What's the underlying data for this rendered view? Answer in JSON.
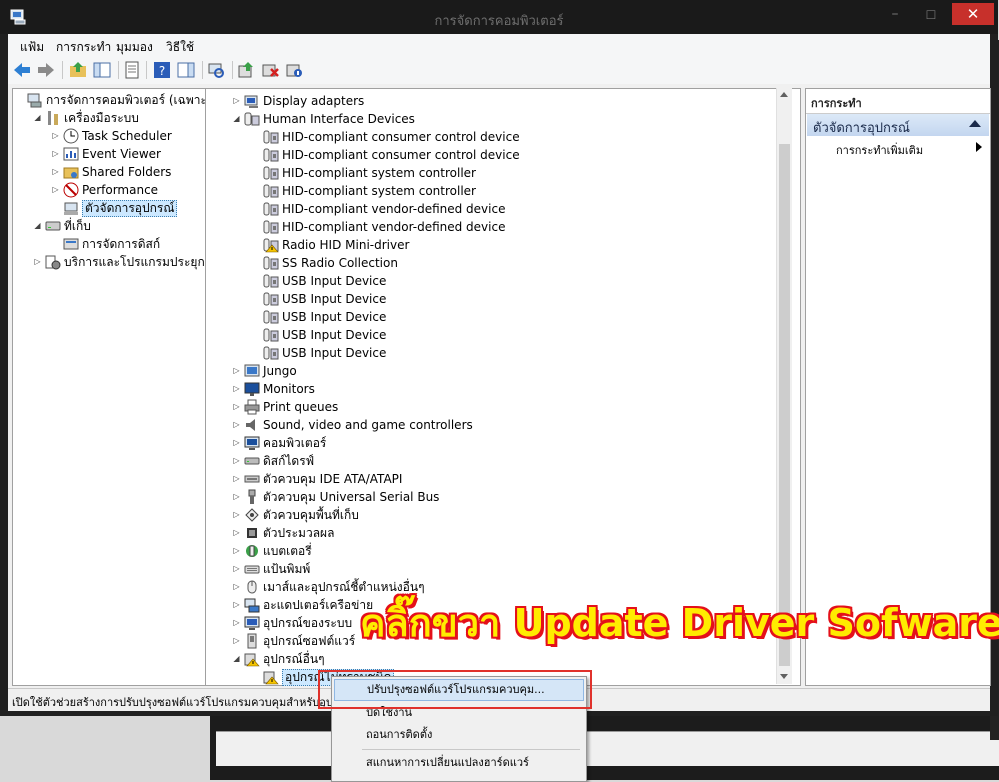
{
  "window": {
    "title": "การจัดการคอมพิวเตอร์",
    "minimize_glyph": "–",
    "maximize_glyph": "☐",
    "close_glyph": "✕"
  },
  "menu": [
    "แฟ้ม",
    "การกระทำ",
    "มุมมอง",
    "วิธีใช้"
  ],
  "left_tree": [
    {
      "label": "การจัดการคอมพิวเตอร์ (เฉพาะที่)",
      "icon": "computer-management-icon",
      "level": 0,
      "arrow": ""
    },
    {
      "label": "เครื่องมือระบบ",
      "icon": "tools-icon",
      "level": 1,
      "arrow": "expanded"
    },
    {
      "label": "Task Scheduler",
      "icon": "clock-icon",
      "level": 2,
      "arrow": "collapsed"
    },
    {
      "label": "Event Viewer",
      "icon": "event-viewer-icon",
      "level": 2,
      "arrow": "collapsed"
    },
    {
      "label": "Shared Folders",
      "icon": "shared-folder-icon",
      "level": 2,
      "arrow": "collapsed"
    },
    {
      "label": "Performance",
      "icon": "performance-icon",
      "level": 2,
      "arrow": "collapsed"
    },
    {
      "label": "ตัวจัดการอุปกรณ์",
      "icon": "device-manager-icon",
      "level": 2,
      "arrow": "",
      "selected": true
    },
    {
      "label": "ที่เก็บ",
      "icon": "storage-icon",
      "level": 1,
      "arrow": "expanded"
    },
    {
      "label": "การจัดการดิสก์",
      "icon": "disk-icon",
      "level": 2,
      "arrow": ""
    },
    {
      "label": "บริการและโปรแกรมประยุกต์",
      "icon": "services-icon",
      "level": 1,
      "arrow": "collapsed"
    }
  ],
  "device_tree": [
    {
      "label": "Display adapters",
      "icon": "display-adapter-icon",
      "level": 0,
      "arrow": "collapsed"
    },
    {
      "label": "Human Interface Devices",
      "icon": "hid-icon",
      "level": 0,
      "arrow": "expanded"
    },
    {
      "label": "HID-compliant consumer control device",
      "icon": "hid-device-icon",
      "level": 1
    },
    {
      "label": "HID-compliant consumer control device",
      "icon": "hid-device-icon",
      "level": 1
    },
    {
      "label": "HID-compliant system controller",
      "icon": "hid-device-icon",
      "level": 1
    },
    {
      "label": "HID-compliant system controller",
      "icon": "hid-device-icon",
      "level": 1
    },
    {
      "label": "HID-compliant vendor-defined device",
      "icon": "hid-device-icon",
      "level": 1
    },
    {
      "label": "HID-compliant vendor-defined device",
      "icon": "hid-device-icon",
      "level": 1
    },
    {
      "label": "Radio HID Mini-driver",
      "icon": "hid-warning-icon",
      "level": 1
    },
    {
      "label": "SS Radio Collection",
      "icon": "hid-device-icon",
      "level": 1
    },
    {
      "label": "USB Input Device",
      "icon": "hid-device-icon",
      "level": 1
    },
    {
      "label": "USB Input Device",
      "icon": "hid-device-icon",
      "level": 1
    },
    {
      "label": "USB Input Device",
      "icon": "hid-device-icon",
      "level": 1
    },
    {
      "label": "USB Input Device",
      "icon": "hid-device-icon",
      "level": 1
    },
    {
      "label": "USB Input Device",
      "icon": "hid-device-icon",
      "level": 1
    },
    {
      "label": "Jungo",
      "icon": "jungo-icon",
      "level": 0,
      "arrow": "collapsed"
    },
    {
      "label": "Monitors",
      "icon": "monitor-icon",
      "level": 0,
      "arrow": "collapsed"
    },
    {
      "label": "Print queues",
      "icon": "printer-icon",
      "level": 0,
      "arrow": "collapsed"
    },
    {
      "label": "Sound, video and game controllers",
      "icon": "speaker-icon",
      "level": 0,
      "arrow": "collapsed"
    },
    {
      "label": "คอมพิวเตอร์",
      "icon": "computer-icon",
      "level": 0,
      "arrow": "collapsed"
    },
    {
      "label": "ดิสก์ไดรฟ์",
      "icon": "disk-drive-icon",
      "level": 0,
      "arrow": "collapsed"
    },
    {
      "label": "ตัวควบคุม IDE ATA/ATAPI",
      "icon": "ide-icon",
      "level": 0,
      "arrow": "collapsed"
    },
    {
      "label": "ตัวควบคุม Universal Serial Bus",
      "icon": "usb-icon",
      "level": 0,
      "arrow": "collapsed"
    },
    {
      "label": "ตัวควบคุมพื้นที่เก็บ",
      "icon": "storage-controller-icon",
      "level": 0,
      "arrow": "collapsed"
    },
    {
      "label": "ตัวประมวลผล",
      "icon": "processor-icon",
      "level": 0,
      "arrow": "collapsed"
    },
    {
      "label": "แบตเตอรี่",
      "icon": "battery-icon",
      "level": 0,
      "arrow": "collapsed"
    },
    {
      "label": "แป้นพิมพ์",
      "icon": "keyboard-icon",
      "level": 0,
      "arrow": "collapsed"
    },
    {
      "label": "เมาส์และอุปกรณ์ชี้ตำแหน่งอื่นๆ",
      "icon": "mouse-icon",
      "level": 0,
      "arrow": "collapsed"
    },
    {
      "label": "อะแดปเตอร์เครือข่าย",
      "icon": "network-adapter-icon",
      "level": 0,
      "arrow": "collapsed"
    },
    {
      "label": "อุปกรณ์ของระบบ",
      "icon": "system-device-icon",
      "level": 0,
      "arrow": "collapsed"
    },
    {
      "label": "อุปกรณ์ซอฟต์แวร์",
      "icon": "software-device-icon",
      "level": 0,
      "arrow": "collapsed"
    },
    {
      "label": "อุปกรณ์อื่นๆ",
      "icon": "other-devices-icon",
      "level": 0,
      "arrow": "expanded"
    },
    {
      "label": "อุปกรณ์ไม่ทราบชนิด",
      "icon": "unknown-device-warning-icon",
      "level": 1,
      "selected": true
    }
  ],
  "actions_pane": {
    "header": "การกระทำ",
    "section": "ตัวจัดการอุปกรณ์",
    "more": "การกระทำเพิ่มเติม"
  },
  "context_menu": {
    "update": "ปรับปรุงซอฟต์แวร์โปรแกรมควบคุม...",
    "disable": "ปิดใช้งาน",
    "uninstall": "ถอนการติดตั้ง",
    "scan": "สแกนหาการเปลี่ยนแปลงฮาร์ดแวร์"
  },
  "status": "เปิดใช้ตัวช่วยสร้างการปรับปรุงซอฟต์แวร์โปรแกรมควบคุมสำหรับอุปกรณ์",
  "annotation": "คลิ๊กขวา Update Driver Sofware",
  "colors": {
    "highlight_border": "#e0322c",
    "annotation_fill": "#ffec00",
    "annotation_outline": "#e4101a",
    "close_button": "#c7302b"
  }
}
